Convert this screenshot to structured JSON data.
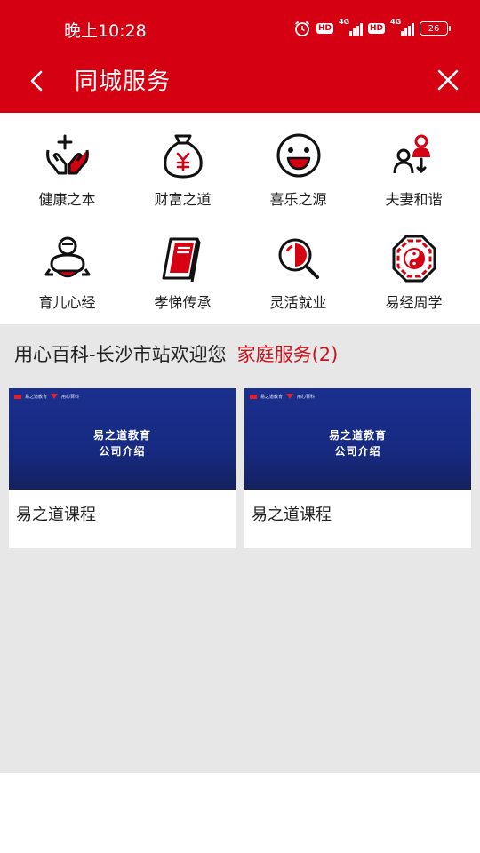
{
  "status_bar": {
    "time": "晚上10:28",
    "network_1": "4G",
    "network_2": "4G",
    "hd_1": "HD",
    "hd_2": "HD",
    "battery": "26",
    "icons": [
      "alarm-icon",
      "hd-icon",
      "signal-4g-icon",
      "hd-icon",
      "signal-4g-icon",
      "battery-icon"
    ]
  },
  "header": {
    "title": "同城服务",
    "back_icon": "chevron-left-icon",
    "close_icon": "close-icon",
    "background_color": "#d50012"
  },
  "categories": [
    {
      "label": "健康之本",
      "icon": "health-hands-icon"
    },
    {
      "label": "财富之道",
      "icon": "money-bag-icon"
    },
    {
      "label": "喜乐之源",
      "icon": "smile-face-icon"
    },
    {
      "label": "夫妻和谐",
      "icon": "couple-icon"
    },
    {
      "label": "育儿心经",
      "icon": "baby-icon"
    },
    {
      "label": "孝悌传承",
      "icon": "book-icon"
    },
    {
      "label": "灵活就业",
      "icon": "search-job-icon"
    },
    {
      "label": "易经周学",
      "icon": "bagua-icon"
    }
  ],
  "section": {
    "heading": "用心百科-长沙市站欢迎您",
    "link": "家庭服务(2)",
    "link_color": "#c8141e"
  },
  "cards": [
    {
      "thumb_line1": "易之道教育",
      "thumb_line2": "公司介绍",
      "title": "易之道课程"
    },
    {
      "thumb_line1": "易之道教育",
      "thumb_line2": "公司介绍",
      "title": "易之道课程"
    }
  ]
}
